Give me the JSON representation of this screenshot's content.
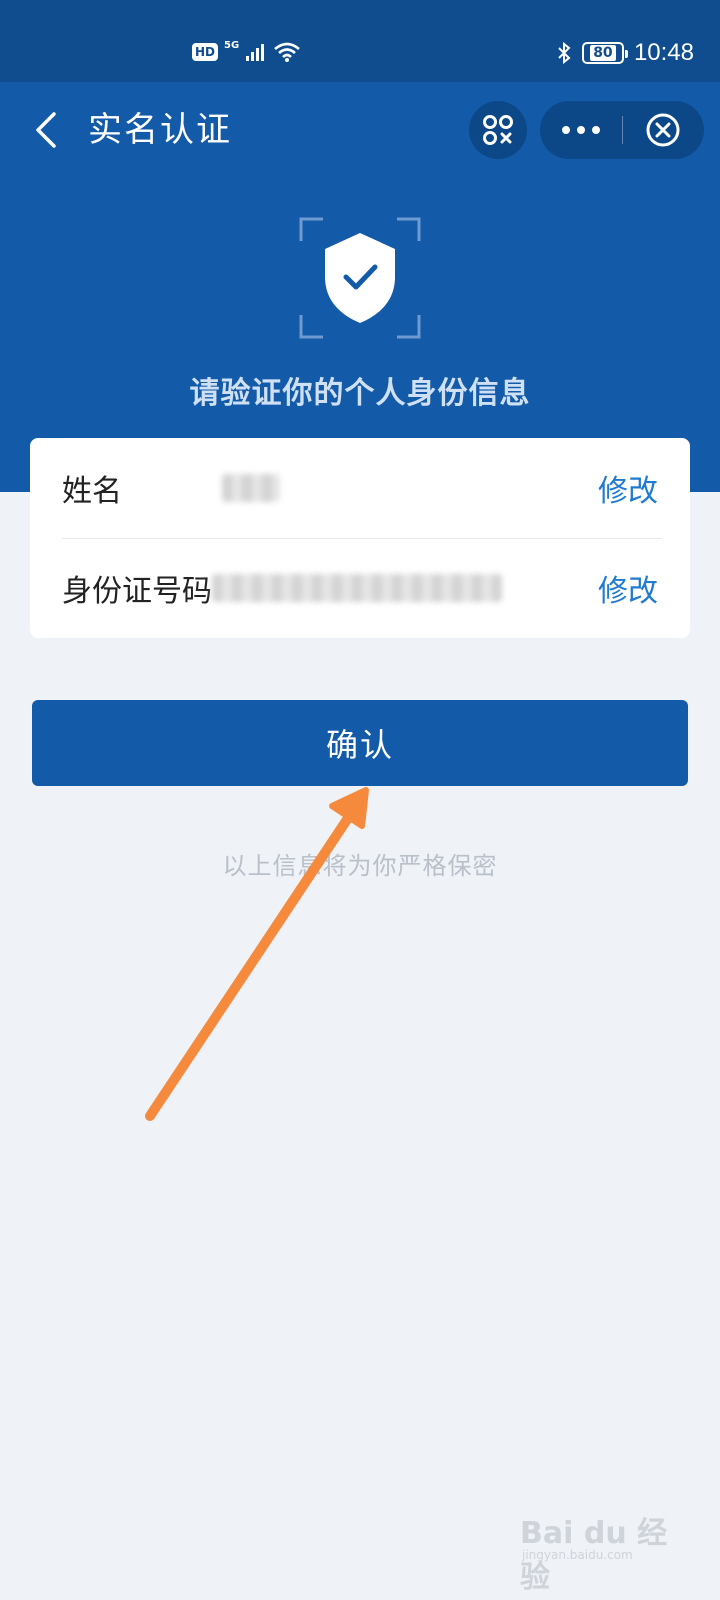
{
  "status_bar": {
    "hd": "HD",
    "network": "5G",
    "battery": "80",
    "time": "10:48"
  },
  "nav": {
    "title": "实名认证"
  },
  "hero": {
    "prompt": "请验证你的个人身份信息"
  },
  "form": {
    "rows": [
      {
        "label": "姓名",
        "edit_label": "修改"
      },
      {
        "label": "身份证号码",
        "edit_label": "修改"
      }
    ]
  },
  "confirm_label": "确认",
  "privacy_note": "以上信息将为你严格保密",
  "colors": {
    "primary": "#135aa8",
    "status_bar": "#0f4d8f",
    "link": "#1f7ad1",
    "background": "#eff2f7",
    "annotation_arrow": "#f58a3c"
  },
  "watermark": {
    "text": "Bai du 经验",
    "sub": "jingyan.baidu.com"
  }
}
